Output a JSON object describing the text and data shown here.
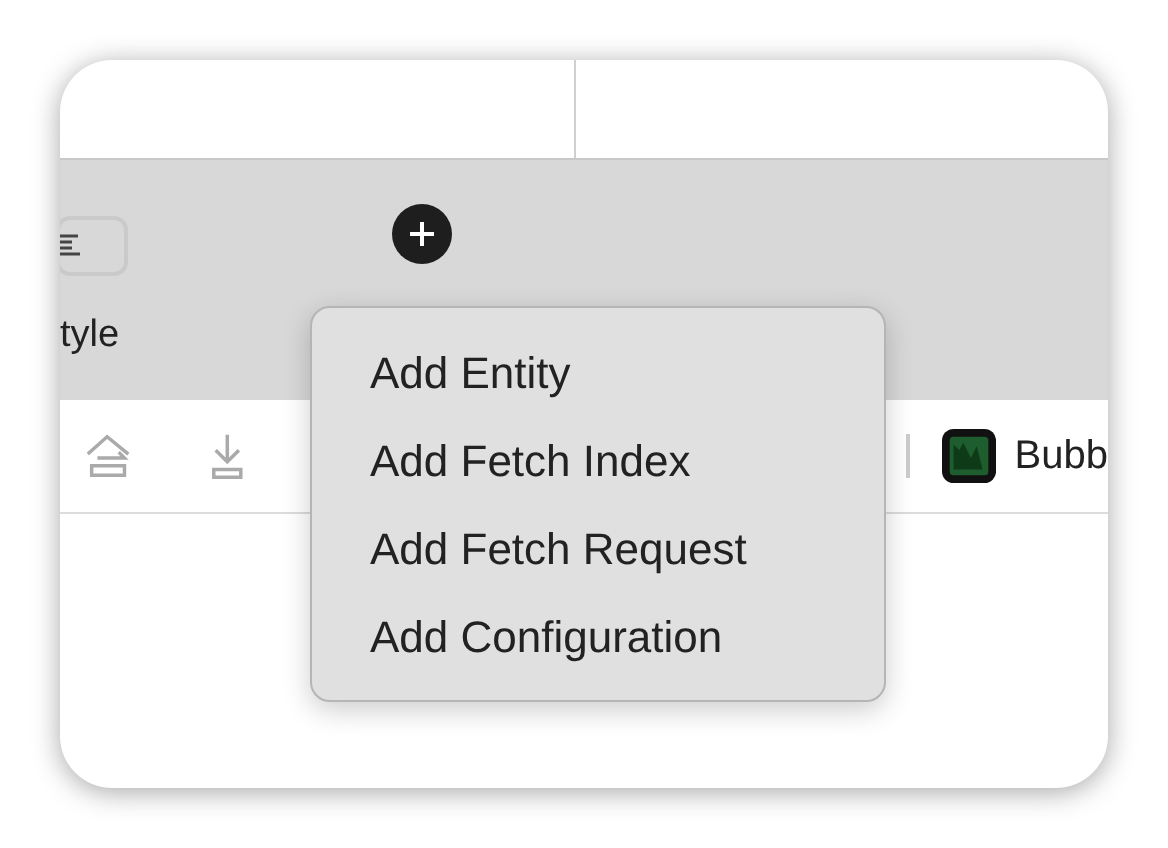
{
  "toolbar": {
    "style_label": "tyle"
  },
  "editor_bar": {
    "file_name": "Bubb"
  },
  "menu": {
    "items": [
      {
        "label": "Add Entity"
      },
      {
        "label": "Add Fetch Index"
      },
      {
        "label": "Add Fetch Request"
      },
      {
        "label": "Add Configuration"
      }
    ]
  }
}
